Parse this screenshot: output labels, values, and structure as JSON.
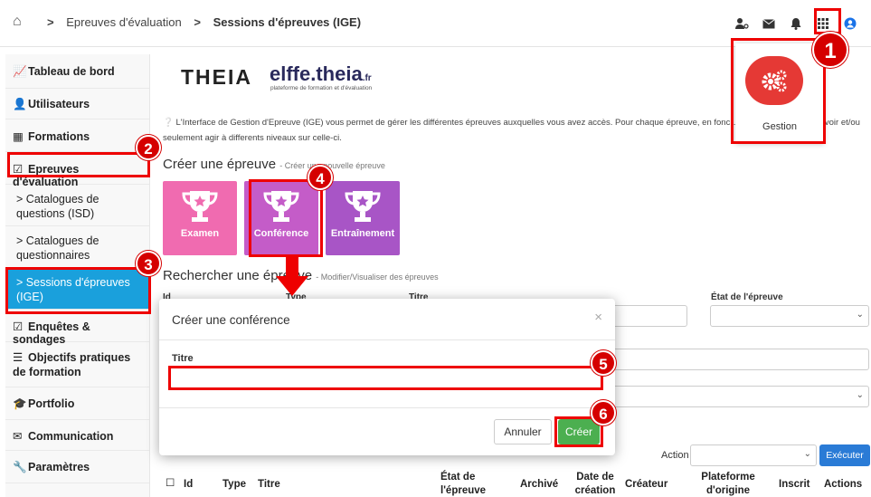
{
  "breadcrumb": {
    "items": [
      "Epreuves d'évaluation",
      "Sessions d'épreuves (IGE)"
    ]
  },
  "topbar": {
    "icons": [
      "user-key-icon",
      "envelope-icon",
      "bell-icon",
      "grid-icon",
      "user-circle-icon"
    ]
  },
  "sidebar": {
    "items": [
      {
        "label": "Tableau de bord",
        "icon": "dashboard-icon"
      },
      {
        "label": "Utilisateurs",
        "icon": "user-icon"
      },
      {
        "label": "Formations",
        "icon": "book-icon"
      },
      {
        "label": "Epreuves d'évaluation",
        "icon": "checkbox-icon"
      },
      {
        "label": "Catalogues de questions (ISD)",
        "icon": "chevron-right-icon"
      },
      {
        "label": "Catalogues de questionnaires",
        "icon": "chevron-right-icon"
      },
      {
        "label": "Sessions d'épreuves (IGE)",
        "icon": "chevron-right-icon"
      },
      {
        "label": "Enquêtes & sondages",
        "icon": "checkbox-icon"
      },
      {
        "label": "Objectifs pratiques de formation",
        "icon": "list-icon"
      },
      {
        "label": "Portfolio",
        "icon": "graduation-cap-icon"
      },
      {
        "label": "Communication",
        "icon": "envelope-icon"
      },
      {
        "label": "Paramètres",
        "icon": "wrench-icon"
      }
    ]
  },
  "logo": {
    "theia": "THEIA",
    "elffe": "elffe.theia",
    "elffe_tld": ".fr",
    "tagline": "plateforme de formation et d'évaluation"
  },
  "intro_text": "L'Interface de Gestion d'Epreuve (IGE) vous permet de gérer les différentes épreuves auxquelles vous avez accès. Pour chaque épreuve, en fonc… …urrez la modifier, la voir et/ou seulement agir à differents niveaux sur celle-ci.",
  "create_section": {
    "title": "Créer une épreuve",
    "subtitle": "- Créer une nouvelle épreuve",
    "tiles": [
      {
        "label": "Examen",
        "color": "#f06bb0"
      },
      {
        "label": "Conférence",
        "color": "#c45cc8"
      },
      {
        "label": "Entraînement",
        "color": "#a855c6"
      }
    ]
  },
  "search_section": {
    "title": "Rechercher une épreuve",
    "subtitle": "- Modifier/Visualiser des épreuves",
    "labels": {
      "id": "Id",
      "type": "Type",
      "titre": "Titre",
      "etat": "État de l'épreuve"
    }
  },
  "gestion": {
    "label": "Gestion",
    "color": "#e53935"
  },
  "modal": {
    "title": "Créer une conférence",
    "close": "×",
    "field_label": "Titre",
    "field_value": "",
    "cancel_label": "Annuler",
    "create_label": "Créer"
  },
  "action_bar": {
    "label": "Action",
    "execute_label": "Exécuter"
  },
  "table": {
    "headers": [
      "Id",
      "Type",
      "Titre",
      "État de l'épreuve",
      "Archivé",
      "Date de création",
      "Créateur",
      "Plateforme d'origine",
      "Inscrit",
      "Actions"
    ]
  },
  "annotations": [
    "1",
    "2",
    "3",
    "4",
    "5",
    "6"
  ],
  "colors": {
    "accent": "#1aa0dc",
    "annotation": "#e00000",
    "create_button": "#4caf50",
    "execute_button": "#2a7bd6"
  }
}
